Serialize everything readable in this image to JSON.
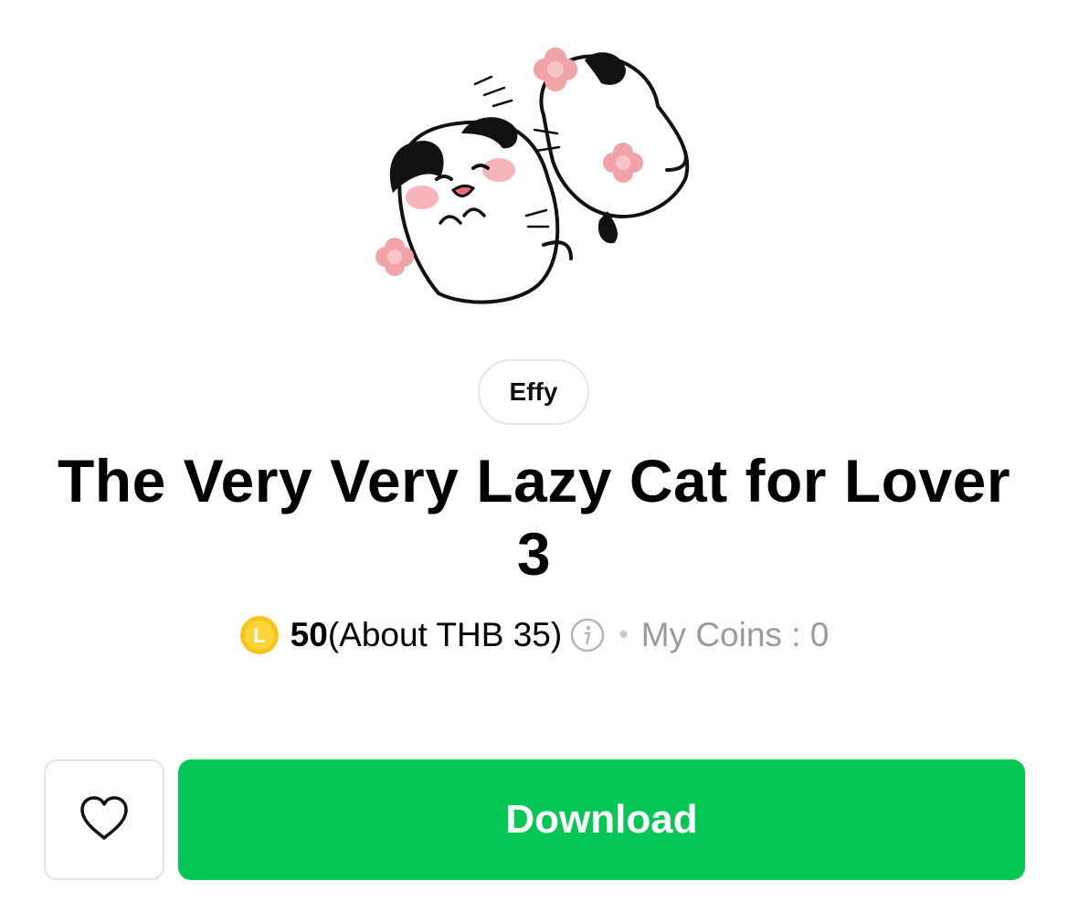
{
  "sticker": {
    "image_icon": "two-lazy-cats-sticker"
  },
  "author": {
    "name": "Effy"
  },
  "title": "The Very Very Lazy Cat for Lover 3",
  "price": {
    "coin_icon": "line-coin-icon",
    "coin_letter": "L",
    "amount": "50",
    "approx": "(About THB 35)",
    "info_icon": "info-icon",
    "separator": "•",
    "my_coins": "My Coins : 0"
  },
  "actions": {
    "favorite_icon": "heart-icon",
    "download_label": "Download"
  },
  "colors": {
    "primary_green": "#06c755",
    "coin_gold": "#f5c518",
    "muted_text": "#9a9a9a",
    "border": "#e3e3e3",
    "blush_pink": "#f4a7ad"
  }
}
